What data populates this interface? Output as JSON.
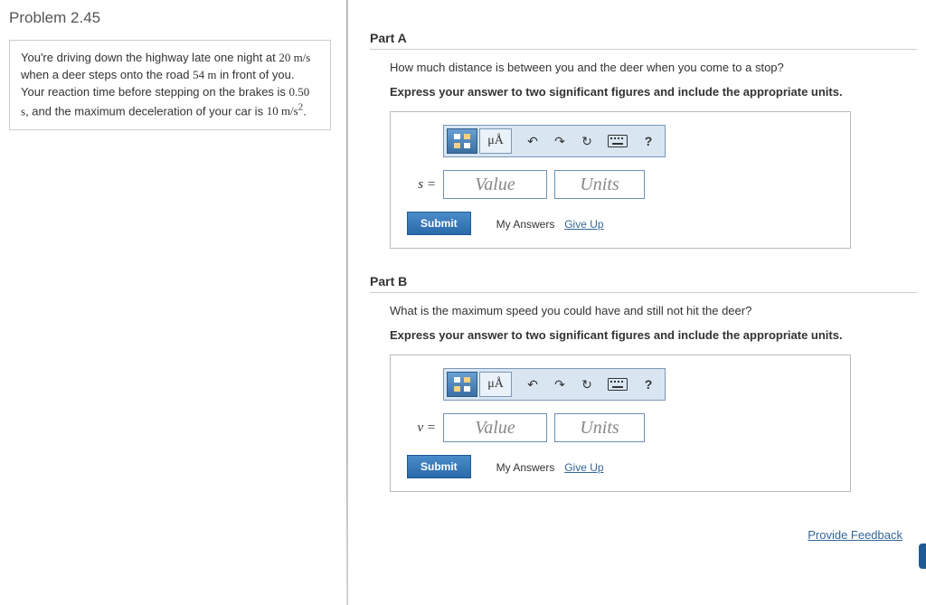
{
  "problem": {
    "title": "Problem 2.45",
    "text_html": "You're driving down the highway late one night at <span class='mathvar'>20 m/s</span> when a deer steps onto the road <span class='mathvar'>54 m</span> in front of you. Your reaction time before stepping on the brakes is <span class='mathvar'>0.50 s</span>, and the maximum deceleration of your car is <span class='mathvar'>10 m/s<sup>2</sup></span>."
  },
  "parts": {
    "a": {
      "title": "Part A",
      "question": "How much distance is between you and the deer when you come to a stop?",
      "instruction": "Express your answer to two significant figures and include the appropriate units.",
      "var_label": "s =",
      "value_placeholder": "Value",
      "units_placeholder": "Units",
      "submit": "Submit",
      "my_answers": "My Answers",
      "give_up": "Give Up"
    },
    "b": {
      "title": "Part B",
      "question": "What is the maximum speed you could have and still not hit the deer?",
      "instruction": "Express your answer to two significant figures and include the appropriate units.",
      "var_label": "v =",
      "value_placeholder": "Value",
      "units_placeholder": "Units",
      "submit": "Submit",
      "my_answers": "My Answers",
      "give_up": "Give Up"
    }
  },
  "toolbar": {
    "ua_label": "μÅ",
    "help": "?"
  },
  "feedback": "Provide Feedback"
}
